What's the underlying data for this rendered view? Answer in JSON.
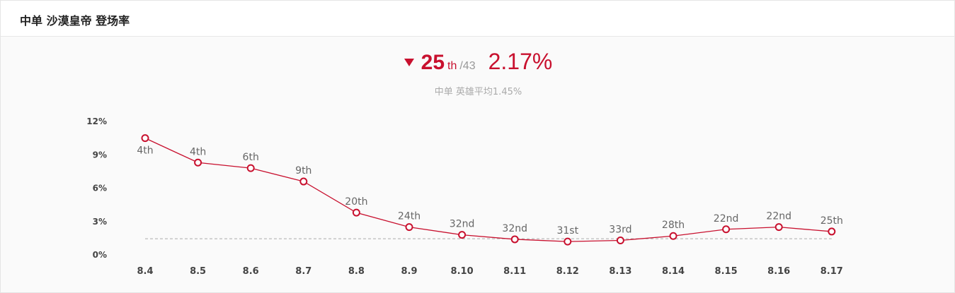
{
  "header": {
    "title": "中单 沙漠皇帝 登场率"
  },
  "summary": {
    "trend": "down",
    "rank": "25",
    "rank_suffix": "th",
    "rank_total": "/43",
    "rate": "2.17%",
    "average_text": "中单 英雄平均1.45%"
  },
  "colors": {
    "accent": "#c8102e",
    "avg_line": "#aaaaaa"
  },
  "chart_data": {
    "type": "line",
    "title": "",
    "xlabel": "",
    "ylabel": "",
    "categories": [
      "8.4",
      "8.5",
      "8.6",
      "8.7",
      "8.8",
      "8.9",
      "8.10",
      "8.11",
      "8.12",
      "8.13",
      "8.14",
      "8.15",
      "8.16",
      "8.17"
    ],
    "series": [
      {
        "values": [
          10.5,
          8.3,
          7.8,
          6.6,
          3.8,
          2.5,
          1.8,
          1.4,
          1.2,
          1.3,
          1.7,
          2.3,
          2.5,
          2.1
        ],
        "labels": [
          "4th",
          "4th",
          "6th",
          "9th",
          "20th",
          "24th",
          "32nd",
          "32nd",
          "31st",
          "33rd",
          "28th",
          "22nd",
          "22nd",
          "25th"
        ]
      }
    ],
    "reference_line": 1.45,
    "ylim": [
      0,
      12
    ],
    "yticks": [
      "12%",
      "9%",
      "6%",
      "3%",
      "0%"
    ],
    "ytick_values": [
      12,
      9,
      6,
      3,
      0
    ],
    "grid": false,
    "legend": "none"
  }
}
